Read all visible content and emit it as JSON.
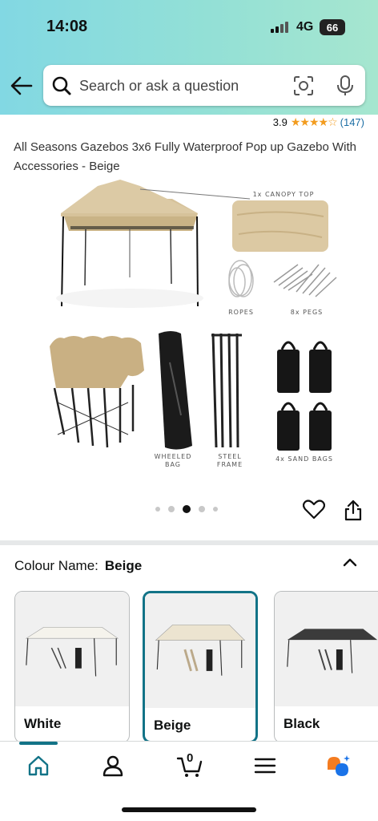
{
  "status": {
    "time": "14:08",
    "network": "4G",
    "battery": "66"
  },
  "search": {
    "placeholder": "Search or ask a question"
  },
  "product": {
    "rating": "3.9",
    "stars": "★★★★☆",
    "review_count": "(147)",
    "title": "All Seasons Gazebos 3x6 Fully Waterproof Pop up Gazebo With Accessories - Beige"
  },
  "gallery": {
    "labels": {
      "canopy": "1x CANOPY TOP",
      "ropes": "ROPES",
      "pegs": "8x PEGS",
      "bag_1": "WHEELED",
      "bag_2": "BAG",
      "frame_1": "STEEL",
      "frame_2": "FRAME",
      "sandbags": "4x SAND BAGS"
    },
    "image_count": 5,
    "active_index": 2
  },
  "colour": {
    "label": "Colour Name:",
    "selected": "Beige",
    "options": [
      {
        "name": "White",
        "canopy": "#f2efe6"
      },
      {
        "name": "Beige",
        "canopy": "#ece4d0"
      },
      {
        "name": "Black",
        "canopy": "#3b3b3b"
      }
    ]
  },
  "nav": {
    "cart_count": "0"
  },
  "colors": {
    "accent": "#127387",
    "star": "#f29c1f",
    "link": "#1d6fa5",
    "canopy_beige": "#d6c29a"
  }
}
